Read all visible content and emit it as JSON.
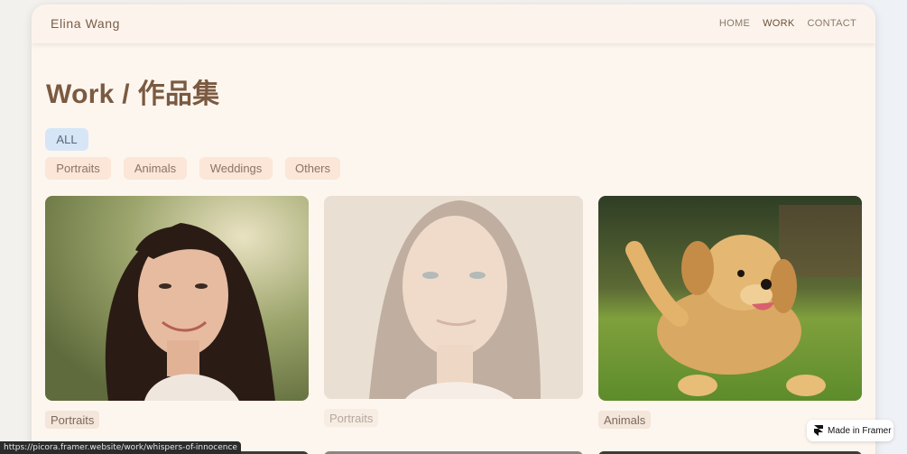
{
  "header": {
    "brand": "Elina Wang",
    "nav": [
      {
        "label": "HOME",
        "active": false
      },
      {
        "label": "WORK",
        "active": true
      },
      {
        "label": "CONTACT",
        "active": false
      }
    ]
  },
  "page_title": "Work / 作品集",
  "filters": {
    "all_label": "ALL",
    "categories": [
      "Portraits",
      "Animals",
      "Weddings",
      "Others"
    ]
  },
  "gallery": [
    {
      "image": "woman-smiling-portrait",
      "category": "Portraits"
    },
    {
      "image": "woman-soft-portrait",
      "category": "Portraits"
    },
    {
      "image": "golden-puppy-running",
      "category": "Animals"
    }
  ],
  "status_url": "https://picora.framer.website/work/whispers-of-innocence",
  "framer_badge": "Made in Framer",
  "colors": {
    "background": "#fdf6ef",
    "accent_brown": "#7a5a40",
    "chip_bg": "#fbe6d7",
    "chip_active_bg": "#d6e6f7"
  }
}
